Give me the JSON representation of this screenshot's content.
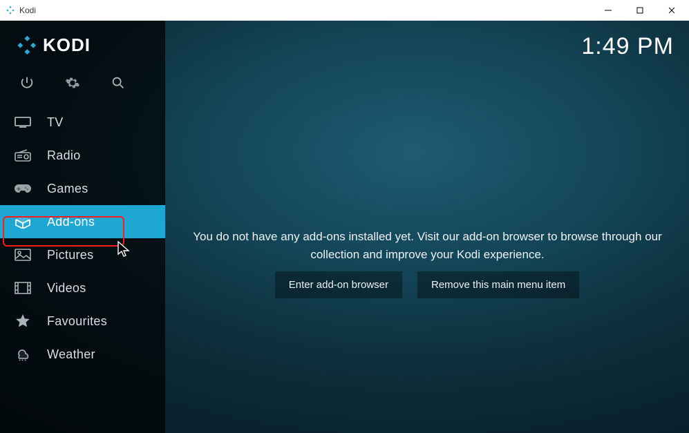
{
  "window": {
    "title": "Kodi"
  },
  "header": {
    "brand": "KODI",
    "clock": "1:49 PM"
  },
  "sidebar": {
    "items": [
      {
        "id": "tv",
        "label": "TV",
        "icon": "tv-icon",
        "selected": false
      },
      {
        "id": "radio",
        "label": "Radio",
        "icon": "radio-icon",
        "selected": false
      },
      {
        "id": "games",
        "label": "Games",
        "icon": "gamepad-icon",
        "selected": false
      },
      {
        "id": "addons",
        "label": "Add-ons",
        "icon": "box-icon",
        "selected": true
      },
      {
        "id": "pictures",
        "label": "Pictures",
        "icon": "image-icon",
        "selected": false
      },
      {
        "id": "videos",
        "label": "Videos",
        "icon": "film-icon",
        "selected": false
      },
      {
        "id": "favourites",
        "label": "Favourites",
        "icon": "star-icon",
        "selected": false
      },
      {
        "id": "weather",
        "label": "Weather",
        "icon": "weather-icon",
        "selected": false
      }
    ]
  },
  "content": {
    "message": "You do not have any add-ons installed yet. Visit our add-on browser to browse through our collection and improve your Kodi experience.",
    "buttons": {
      "enter_browser": "Enter add-on browser",
      "remove_item": "Remove this main menu item"
    }
  }
}
